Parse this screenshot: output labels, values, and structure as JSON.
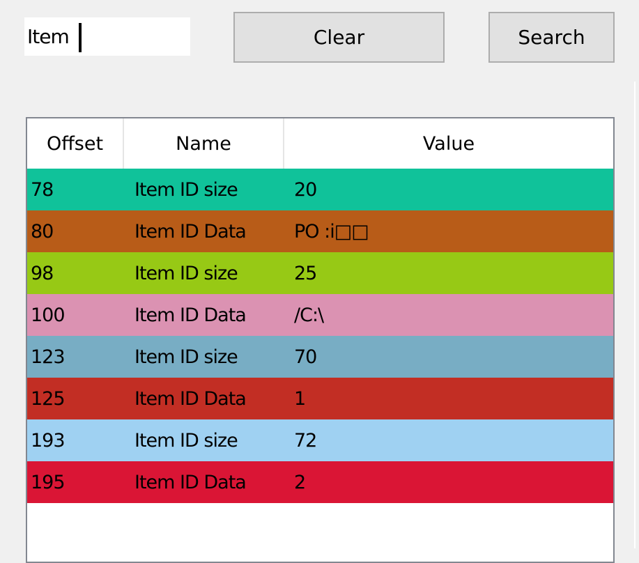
{
  "search": {
    "value": "Item"
  },
  "buttons": {
    "clear_label": "Clear",
    "search_label": "Search"
  },
  "table": {
    "columns": [
      "Offset",
      "Name",
      "Value"
    ],
    "rows": [
      {
        "offset": "78",
        "name": "Item ID size",
        "value": "20",
        "color": "#10c29a"
      },
      {
        "offset": "80",
        "name": "Item ID Data",
        "value": "PO :i□□",
        "color": "#b85c18"
      },
      {
        "offset": "98",
        "name": "Item ID size",
        "value": "25",
        "color": "#97c915"
      },
      {
        "offset": "100",
        "name": "Item ID Data",
        "value": "/C:\\",
        "color": "#db92b2"
      },
      {
        "offset": "123",
        "name": "Item ID size",
        "value": "70",
        "color": "#78adc4"
      },
      {
        "offset": "125",
        "name": "Item ID Data",
        "value": "1",
        "color": "#c22e24"
      },
      {
        "offset": "193",
        "name": "Item ID size",
        "value": "72",
        "color": "#9fd1f2"
      },
      {
        "offset": "195",
        "name": "Item ID Data",
        "value": "2",
        "color": "#da1535"
      }
    ]
  }
}
